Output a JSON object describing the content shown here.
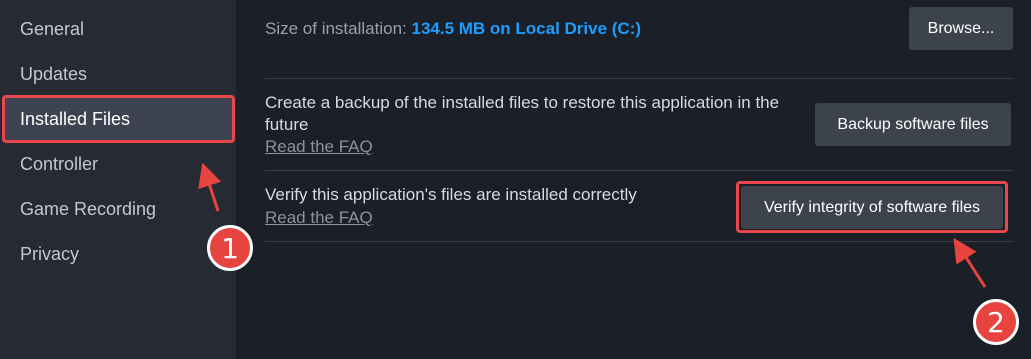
{
  "sidebar": {
    "items": [
      {
        "label": "General"
      },
      {
        "label": "Updates"
      },
      {
        "label": "Installed Files"
      },
      {
        "label": "Controller"
      },
      {
        "label": "Game Recording"
      },
      {
        "label": "Privacy"
      }
    ]
  },
  "install": {
    "size_label": "Size of installation:",
    "size_value": "134.5 MB on Local Drive (C:)",
    "browse_label": "Browse..."
  },
  "backup": {
    "description": "Create a backup of the installed files to restore this application in the future",
    "faq_label": "Read the FAQ",
    "button_label": "Backup software files"
  },
  "verify": {
    "description": "Verify this application's files are installed correctly",
    "faq_label": "Read the FAQ",
    "button_label": "Verify integrity of software files"
  },
  "annotations": {
    "badge_1": "1",
    "badge_2": "2",
    "highlight_color": "#e8474b"
  }
}
